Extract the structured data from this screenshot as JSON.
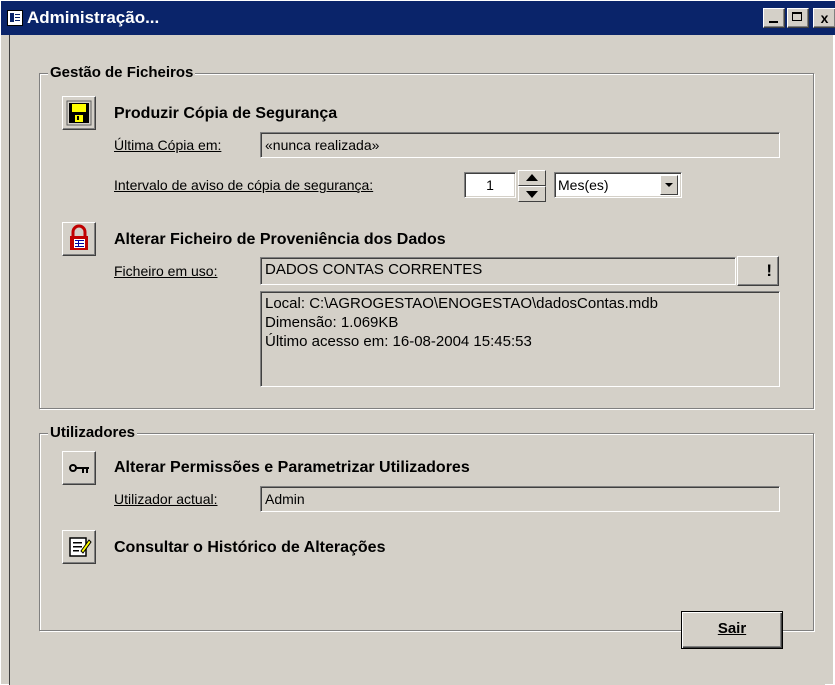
{
  "window": {
    "title": "Administração...",
    "min_glyph": "",
    "max_glyph": "",
    "close_glyph": "x"
  },
  "backup_group": {
    "legend": "Gestão de Ficheiros",
    "backup_title": "Produzir Cópia de Segurança",
    "last_copy_label": "Última Cópia em:",
    "last_copy_value": "«nunca realizada»",
    "interval_label": "Intervalo de aviso de cópia de segurança:",
    "interval_value": "1",
    "interval_unit": "Mes(es)",
    "change_source_title": "Alterar Ficheiro de Proveniência dos Dados",
    "file_in_use_label": "Ficheiro em uso:",
    "file_in_use_value": "DADOS CONTAS CORRENTES",
    "browse_glyph": "!",
    "details": [
      "Local: C:\\AGROGESTAO\\ENOGESTAO\\dadosContas.mdb",
      "Dimensão: 1.069KB",
      "Último acesso em: 16-08-2004 15:45:53"
    ]
  },
  "users_group": {
    "legend": "Utilizadores",
    "permissions_title": "Alterar Permissões e Parametrizar Utilizadores",
    "current_user_label": "Utilizador actual:",
    "current_user_value": "Admin",
    "history_title": "Consultar o Histórico de Alterações"
  },
  "footer": {
    "exit_label": "Sair"
  },
  "colors": {
    "title_bar": "#0a246a",
    "face": "#d4d0c8"
  },
  "icons": {
    "title": "form-icon",
    "backup": "floppy-disk-icon",
    "source": "database-lock-icon",
    "permissions": "key-icon",
    "history": "notepad-pencil-icon",
    "browse": "builder-wand-icon"
  }
}
